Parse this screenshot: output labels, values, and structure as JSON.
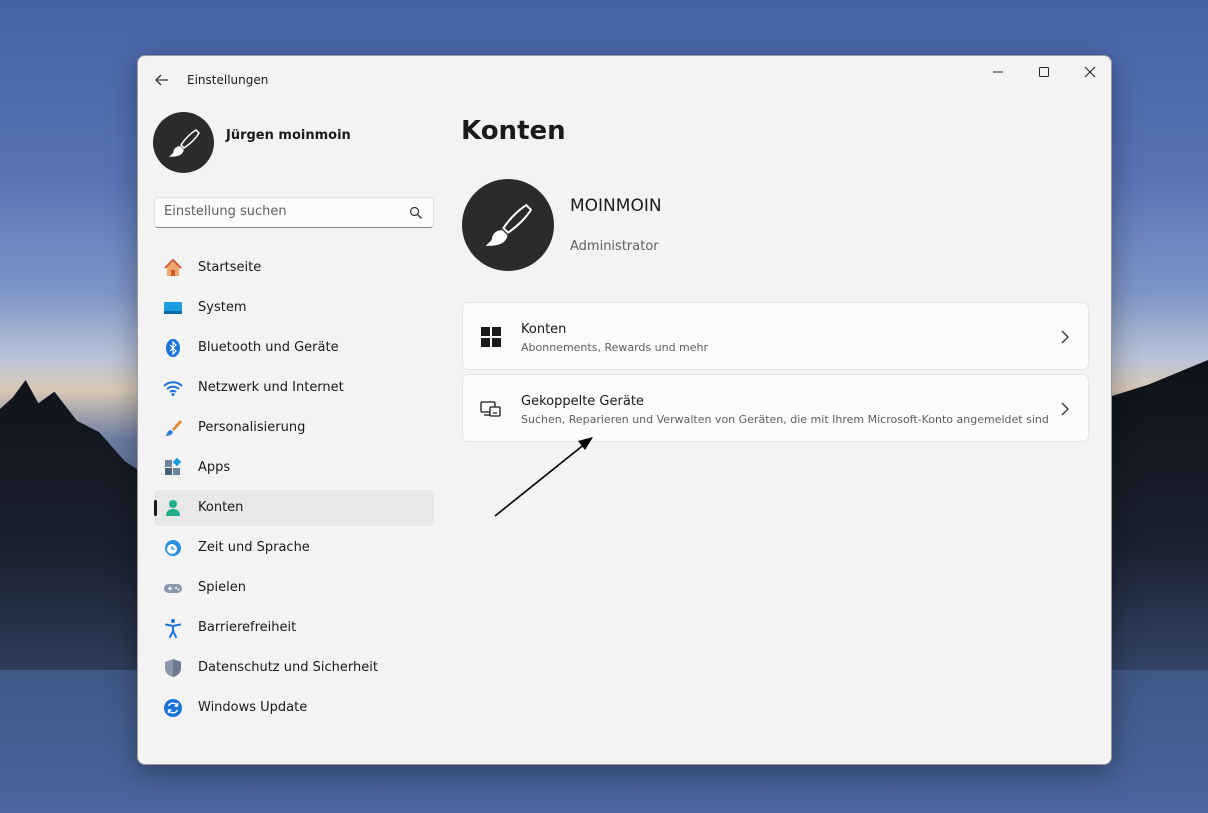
{
  "window": {
    "title": "Einstellungen"
  },
  "profile": {
    "name": "Jürgen moinmoin"
  },
  "search": {
    "placeholder": "Einstellung suchen"
  },
  "sidebar": {
    "items": [
      {
        "label": "Startseite",
        "icon": "home-icon"
      },
      {
        "label": "System",
        "icon": "system-icon"
      },
      {
        "label": "Bluetooth und Geräte",
        "icon": "bluetooth-icon"
      },
      {
        "label": "Netzwerk und Internet",
        "icon": "wifi-icon"
      },
      {
        "label": "Personalisierung",
        "icon": "brush-icon"
      },
      {
        "label": "Apps",
        "icon": "apps-icon"
      },
      {
        "label": "Konten",
        "icon": "person-icon",
        "active": true
      },
      {
        "label": "Zeit und Sprache",
        "icon": "clock-globe-icon"
      },
      {
        "label": "Spielen",
        "icon": "gamepad-icon"
      },
      {
        "label": "Barrierefreiheit",
        "icon": "accessibility-icon"
      },
      {
        "label": "Datenschutz und Sicherheit",
        "icon": "shield-icon"
      },
      {
        "label": "Windows Update",
        "icon": "update-icon"
      }
    ]
  },
  "main": {
    "title": "Konten",
    "account": {
      "name": "MOINMOIN",
      "role": "Administrator"
    },
    "cards": [
      {
        "title": "Konten",
        "subtitle": "Abonnements, Rewards und mehr",
        "icon": "windows-logo-icon"
      },
      {
        "title": "Gekoppelte Geräte",
        "subtitle": "Suchen, Reparieren und Verwalten von Geräten, die mit Ihrem Microsoft-Konto angemeldet sind",
        "icon": "linked-devices-icon"
      }
    ]
  }
}
